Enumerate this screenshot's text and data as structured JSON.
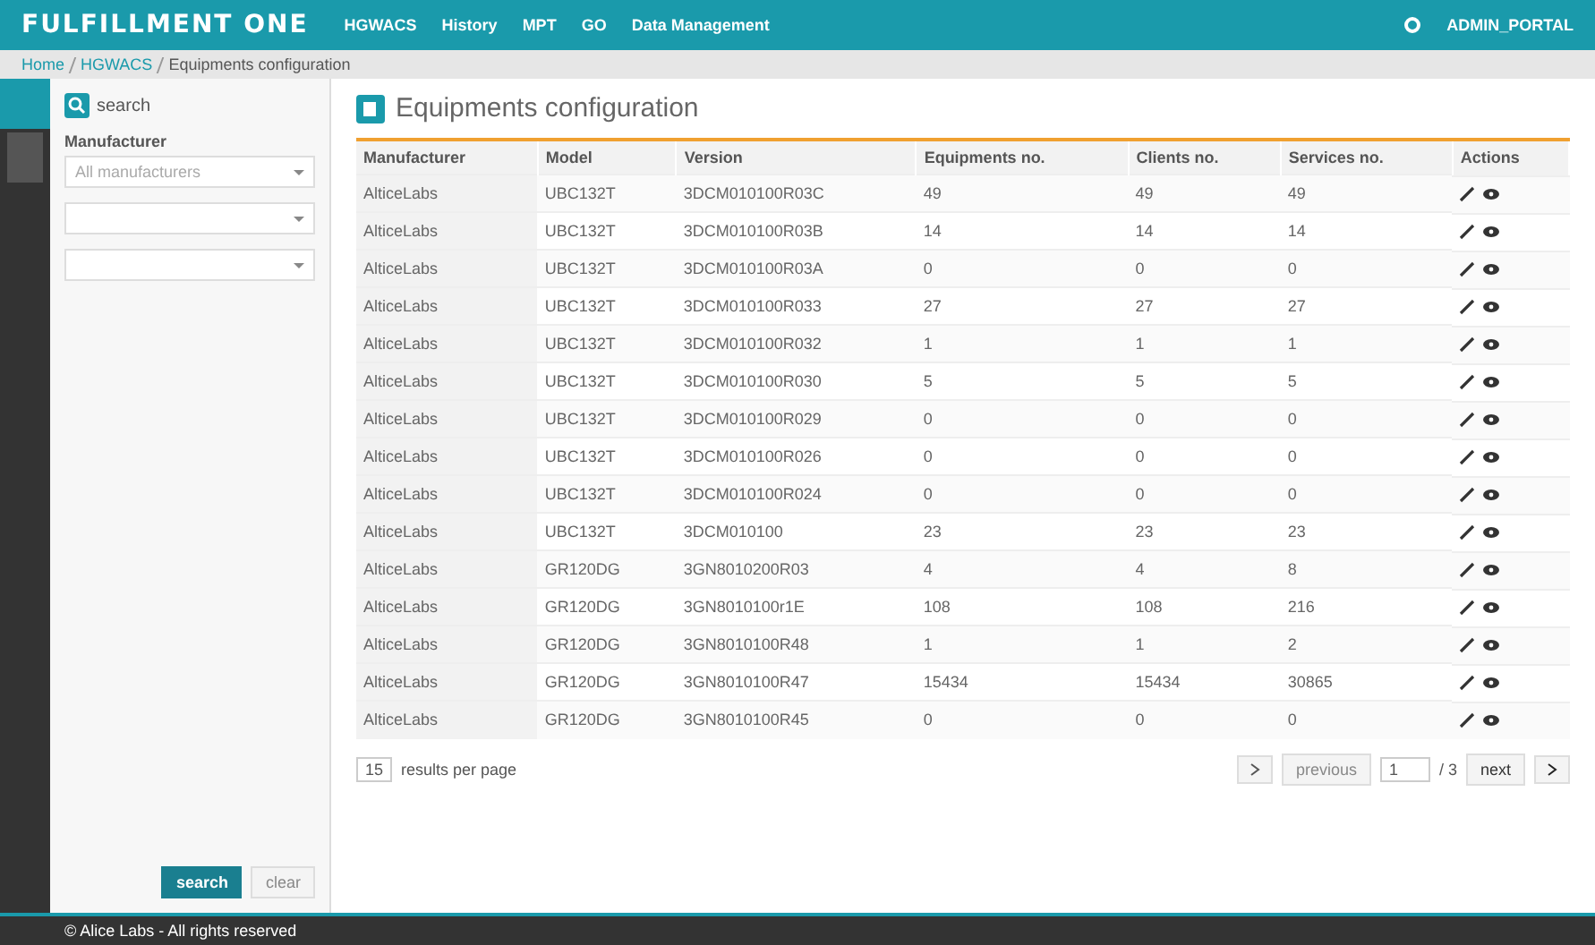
{
  "navbar": {
    "logo": "FULFILLMENT ONE",
    "menu": [
      {
        "label": "HGWACS"
      },
      {
        "label": "History"
      },
      {
        "label": "MPT"
      },
      {
        "label": "GO"
      },
      {
        "label": "Data Management"
      }
    ],
    "user": "ADMIN_PORTAL"
  },
  "breadcrumb": [
    "Home",
    "HGWACS",
    "Equipments configuration"
  ],
  "sidebar": {
    "title": "search",
    "filters": [
      {
        "kind": "dropdown",
        "label": "Manufacturer",
        "placeholder": "All manufacturers"
      },
      {
        "kind": "dropdown"
      },
      {
        "kind": "dropdown"
      }
    ],
    "buttons": [
      "search",
      "clear"
    ]
  },
  "page_title": "Equipments configuration",
  "table": {
    "columns": [
      "Manufacturer",
      "Model",
      "Version",
      "Equipments no.",
      "Clients no.",
      "Services no.",
      "Actions"
    ],
    "rows": [
      [
        "AlticeLabs",
        "UBC132T",
        "3DCM010100R03C",
        "49",
        "49",
        "49"
      ],
      [
        "AlticeLabs",
        "UBC132T",
        "3DCM010100R03B",
        "14",
        "14",
        "14"
      ],
      [
        "AlticeLabs",
        "UBC132T",
        "3DCM010100R03A",
        "0",
        "0",
        "0"
      ],
      [
        "AlticeLabs",
        "UBC132T",
        "3DCM010100R033",
        "27",
        "27",
        "27"
      ],
      [
        "AlticeLabs",
        "UBC132T",
        "3DCM010100R032",
        "1",
        "1",
        "1"
      ],
      [
        "AlticeLabs",
        "UBC132T",
        "3DCM010100R030",
        "5",
        "5",
        "5"
      ],
      [
        "AlticeLabs",
        "UBC132T",
        "3DCM010100R029",
        "0",
        "0",
        "0"
      ],
      [
        "AlticeLabs",
        "UBC132T",
        "3DCM010100R026",
        "0",
        "0",
        "0"
      ],
      [
        "AlticeLabs",
        "UBC132T",
        "3DCM010100R024",
        "0",
        "0",
        "0"
      ],
      [
        "AlticeLabs",
        "UBC132T",
        "3DCM010100",
        "23",
        "23",
        "23"
      ],
      [
        "AlticeLabs",
        "GR120DG",
        "3GN8010200R03",
        "4",
        "4",
        "8"
      ],
      [
        "AlticeLabs",
        "GR120DG",
        "3GN8010100r1E",
        "108",
        "108",
        "216"
      ],
      [
        "AlticeLabs",
        "GR120DG",
        "3GN8010100R48",
        "1",
        "1",
        "2"
      ],
      [
        "AlticeLabs",
        "GR120DG",
        "3GN8010100R47",
        "15434",
        "15434",
        "30865"
      ],
      [
        "AlticeLabs",
        "GR120DG",
        "3GN8010100R45",
        "0",
        "0",
        "0"
      ]
    ]
  },
  "pager": {
    "per_page": "15",
    "per_page_label": "results per page",
    "previous": "previous",
    "page": "1",
    "total": "/ 3",
    "next": "next"
  },
  "footer": "© Alice Labs - All rights reserved"
}
